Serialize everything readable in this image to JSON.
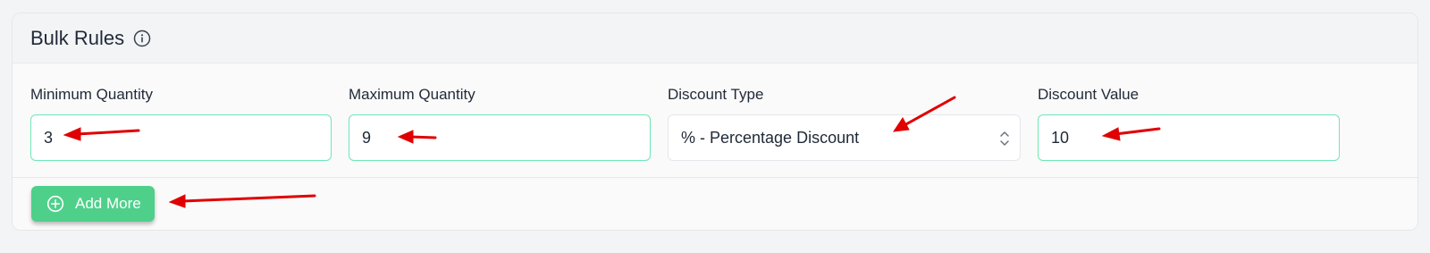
{
  "section": {
    "title": "Bulk Rules",
    "info_icon": "info-circle-icon"
  },
  "fields": {
    "min_quantity": {
      "label": "Minimum Quantity",
      "value": "3"
    },
    "max_quantity": {
      "label": "Maximum Quantity",
      "value": "9"
    },
    "discount_type": {
      "label": "Discount Type",
      "selected": "% - Percentage Discount"
    },
    "discount_value": {
      "label": "Discount Value",
      "value": "10"
    }
  },
  "add_more": {
    "label": "Add More",
    "icon": "plus-circle-icon"
  },
  "colors": {
    "accent_green": "#4fd08a",
    "input_border": "#6ee7b7",
    "annotation_red": "#e00000"
  }
}
